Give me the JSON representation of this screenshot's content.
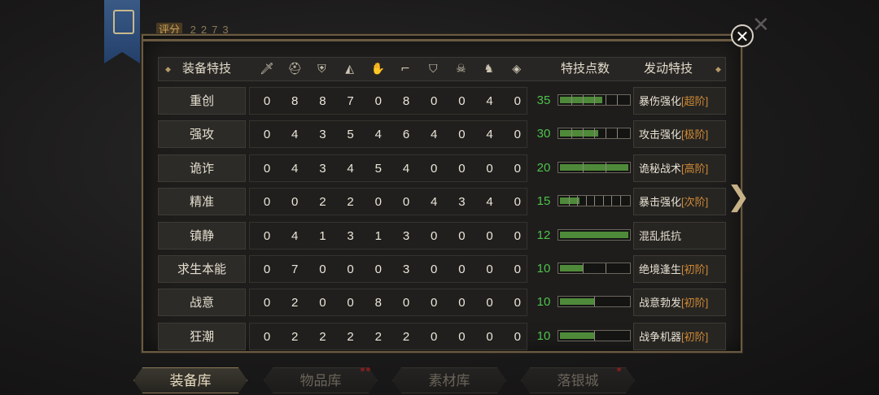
{
  "score": {
    "label": "评分",
    "value": "2273"
  },
  "header": {
    "col_skill": "装备特技",
    "col_points": "特技点数",
    "col_active": "发动特技",
    "slot_icons": [
      "sword-icon",
      "helmet-icon",
      "chest-armor-icon",
      "shoulder-icon",
      "gauntlet-icon",
      "boots-icon",
      "shield-icon",
      "mask-icon",
      "horse-icon",
      "amulet-icon"
    ]
  },
  "rows": [
    {
      "name": "重创",
      "values": [
        0,
        8,
        8,
        7,
        0,
        8,
        0,
        0,
        4,
        0
      ],
      "points": 35,
      "level": 0.62,
      "segments": 6,
      "skill": "暴伤强化",
      "tier": "[超阶]"
    },
    {
      "name": "强攻",
      "values": [
        0,
        4,
        3,
        5,
        4,
        6,
        4,
        0,
        4,
        0
      ],
      "points": 30,
      "level": 0.56,
      "segments": 6,
      "skill": "攻击强化",
      "tier": "[极阶]"
    },
    {
      "name": "诡诈",
      "values": [
        0,
        4,
        3,
        4,
        5,
        4,
        0,
        0,
        0,
        0
      ],
      "points": 20,
      "level": 1.0,
      "segments": 3,
      "skill": "诡秘战术",
      "tier": "[高阶]"
    },
    {
      "name": "精准",
      "values": [
        0,
        0,
        2,
        2,
        0,
        0,
        4,
        3,
        4,
        0
      ],
      "points": 15,
      "level": 0.28,
      "segments": 8,
      "skill": "暴击强化",
      "tier": "[次阶]"
    },
    {
      "name": "镇静",
      "values": [
        0,
        4,
        1,
        3,
        1,
        3,
        0,
        0,
        0,
        0
      ],
      "points": 12,
      "level": 1.0,
      "segments": 1,
      "skill": "混乱抵抗",
      "tier": ""
    },
    {
      "name": "求生本能",
      "values": [
        0,
        7,
        0,
        0,
        0,
        3,
        0,
        0,
        0,
        0
      ],
      "points": 10,
      "level": 0.33,
      "segments": 3,
      "skill": "绝境逢生",
      "tier": "[初阶]"
    },
    {
      "name": "战意",
      "values": [
        0,
        2,
        0,
        0,
        8,
        0,
        0,
        0,
        0,
        0
      ],
      "points": 10,
      "level": 0.5,
      "segments": 2,
      "skill": "战意勃发",
      "tier": "[初阶]"
    },
    {
      "name": "狂潮",
      "values": [
        0,
        2,
        2,
        2,
        2,
        2,
        0,
        0,
        0,
        0
      ],
      "points": 10,
      "level": 0.5,
      "segments": 2,
      "skill": "战争机器",
      "tier": "[初阶]"
    }
  ],
  "tabs": [
    "装备库",
    "物品库",
    "素材库",
    "落银城"
  ],
  "active_tab": 0
}
